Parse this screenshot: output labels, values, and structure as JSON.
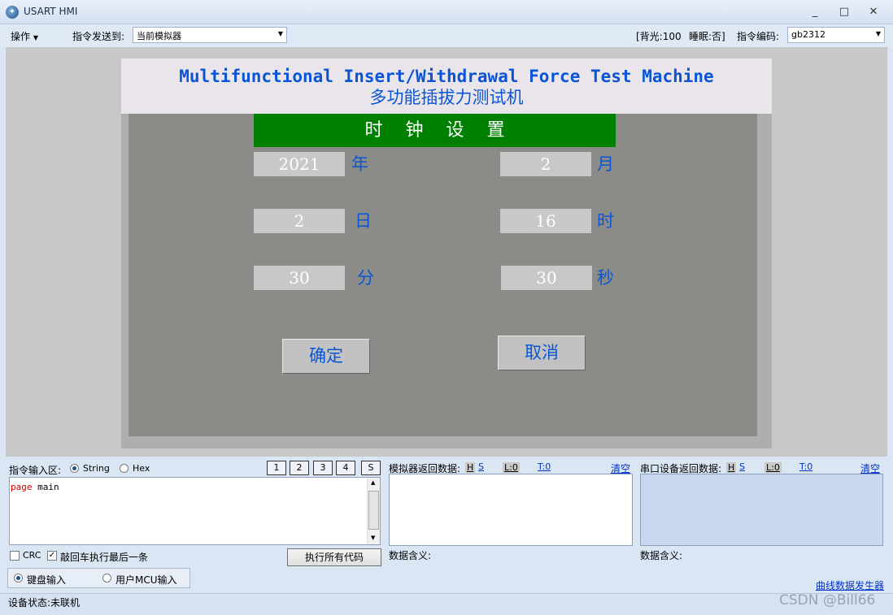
{
  "window": {
    "title": "USART HMI",
    "icon": "app-globe-icon",
    "minimize": "_",
    "maximize": "□",
    "close": "✕"
  },
  "toolbar": {
    "menu_label": "操作",
    "send_to_label": "指令发送到:",
    "send_to_value": "当前模拟器",
    "backlight": "[背光:100",
    "sleep": "睡眠:否]",
    "encoding_label": "指令编码:",
    "encoding_value": "gb2312"
  },
  "hmi": {
    "title_en": "Multifunctional Insert/Withdrawal Force Test Machine",
    "title_cn": "多功能插拔力测试机",
    "banner": "时钟设置",
    "fields": {
      "year": {
        "value": "2021",
        "unit": "年"
      },
      "month": {
        "value": "2",
        "unit": "月"
      },
      "day": {
        "value": "2",
        "unit": "日"
      },
      "hour": {
        "value": "16",
        "unit": "时"
      },
      "minute": {
        "value": "30",
        "unit": "分"
      },
      "second": {
        "value": "30",
        "unit": "秒"
      }
    },
    "confirm": "确定",
    "cancel": "取消",
    "colors": {
      "title": "#0a55d6",
      "banner": "#008000",
      "body": "#8b8c88"
    }
  },
  "input_area": {
    "label": "指令输入区:",
    "mode_string": "String",
    "mode_hex": "Hex",
    "buttons": [
      "1",
      "2",
      "3",
      "4",
      "S"
    ],
    "code_keyword": "page",
    "code_rest": " main",
    "crc_label": "CRC",
    "enter_exec_label": "敲回车执行最后一条",
    "run_all": "执行所有代码",
    "keyboard_input": "键盘输入",
    "mcu_input": "用户MCU输入"
  },
  "sim_return": {
    "label": "模拟器返回数据:",
    "h": "H",
    "s": "S",
    "l": "L:0",
    "t": "T:0",
    "clear": "清空",
    "meaning": "数据含义:"
  },
  "serial_return": {
    "label": "串口设备返回数据:",
    "h": "H",
    "s": "S",
    "l": "L:0",
    "t": "T:0",
    "clear": "清空",
    "meaning": "数据含义:"
  },
  "curve_link": "曲线数据发生器",
  "status": {
    "text": "设备状态:未联机"
  },
  "watermark": "CSDN @Bill66"
}
